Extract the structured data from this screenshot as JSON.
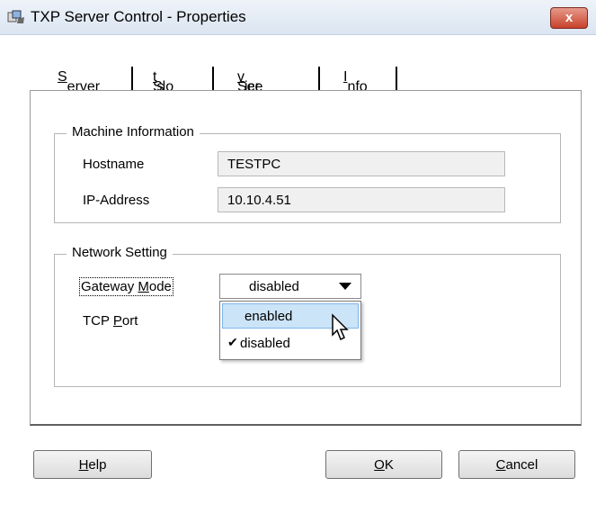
{
  "window": {
    "title": "TXP Server Control - Properties",
    "close_label": "x"
  },
  "tabs": [
    {
      "pre": "",
      "ul": "S",
      "post": "erver"
    },
    {
      "pre": "Slo",
      "ul": "t",
      "post": "s"
    },
    {
      "pre": "Ser",
      "ul": "v",
      "post": "ice"
    },
    {
      "pre": "",
      "ul": "I",
      "post": "nfo"
    }
  ],
  "machine": {
    "group_label": "Machine Information",
    "hostname_label": "Hostname",
    "hostname_value": "TESTPC",
    "ip_label": "IP-Address",
    "ip_value": "10.10.4.51"
  },
  "network": {
    "group_label": "Network Setting",
    "gateway_label_pre": "Gateway ",
    "gateway_label_ul": "M",
    "gateway_label_post": "ode",
    "gateway_value": "disabled",
    "tcp_label_pre": "TCP ",
    "tcp_label_ul": "P",
    "tcp_label_post": "ort",
    "options": [
      "enabled",
      "disabled"
    ],
    "checkmark": "✔"
  },
  "buttons": {
    "help_ul": "H",
    "help_post": "elp",
    "ok_ul": "O",
    "ok_post": "K",
    "cancel_ul": "C",
    "cancel_post": "ancel"
  }
}
